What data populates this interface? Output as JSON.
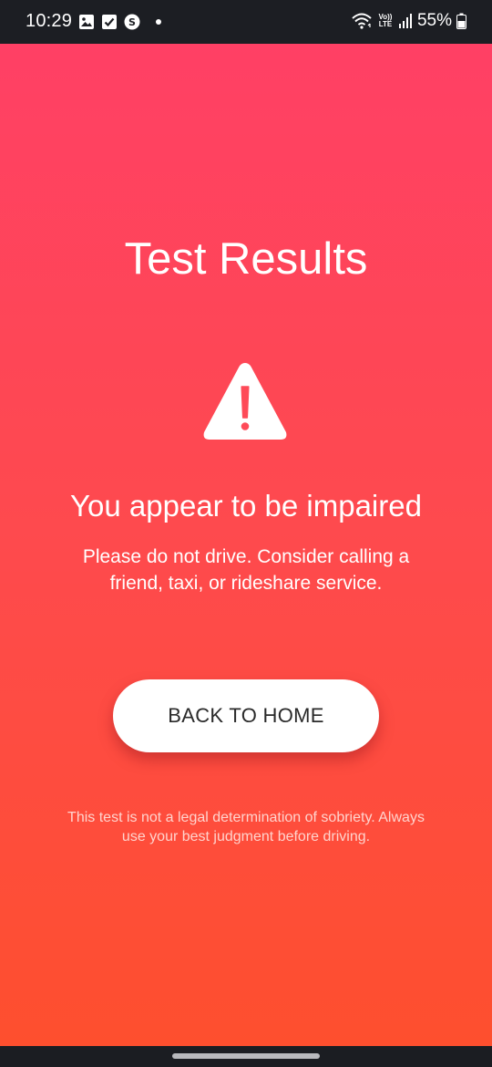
{
  "status_bar": {
    "time": "10:29",
    "battery": "55%",
    "network_label_top": "Vo))",
    "network_label_bottom": "LTE",
    "icons": [
      "image-icon",
      "checkbox-icon",
      "s-app-icon",
      "notification-dot",
      "wifi-icon",
      "volte-icon",
      "signal-icon",
      "battery-icon"
    ]
  },
  "result": {
    "title": "Test Results",
    "icon": "warning-icon",
    "headline": "You appear to be impaired",
    "message": "Please do not drive. Consider calling a friend, taxi, or rideshare service.",
    "button_label": "BACK TO HOME",
    "disclaimer": "This test is not a legal determination of sobriety. Always use your best judgment before driving."
  },
  "colors": {
    "gradient_top": "#ff4065",
    "gradient_bottom": "#fe4f2e",
    "status_bar": "#1c1e23",
    "button_bg": "#ffffff",
    "button_text": "#2a2a2a"
  }
}
